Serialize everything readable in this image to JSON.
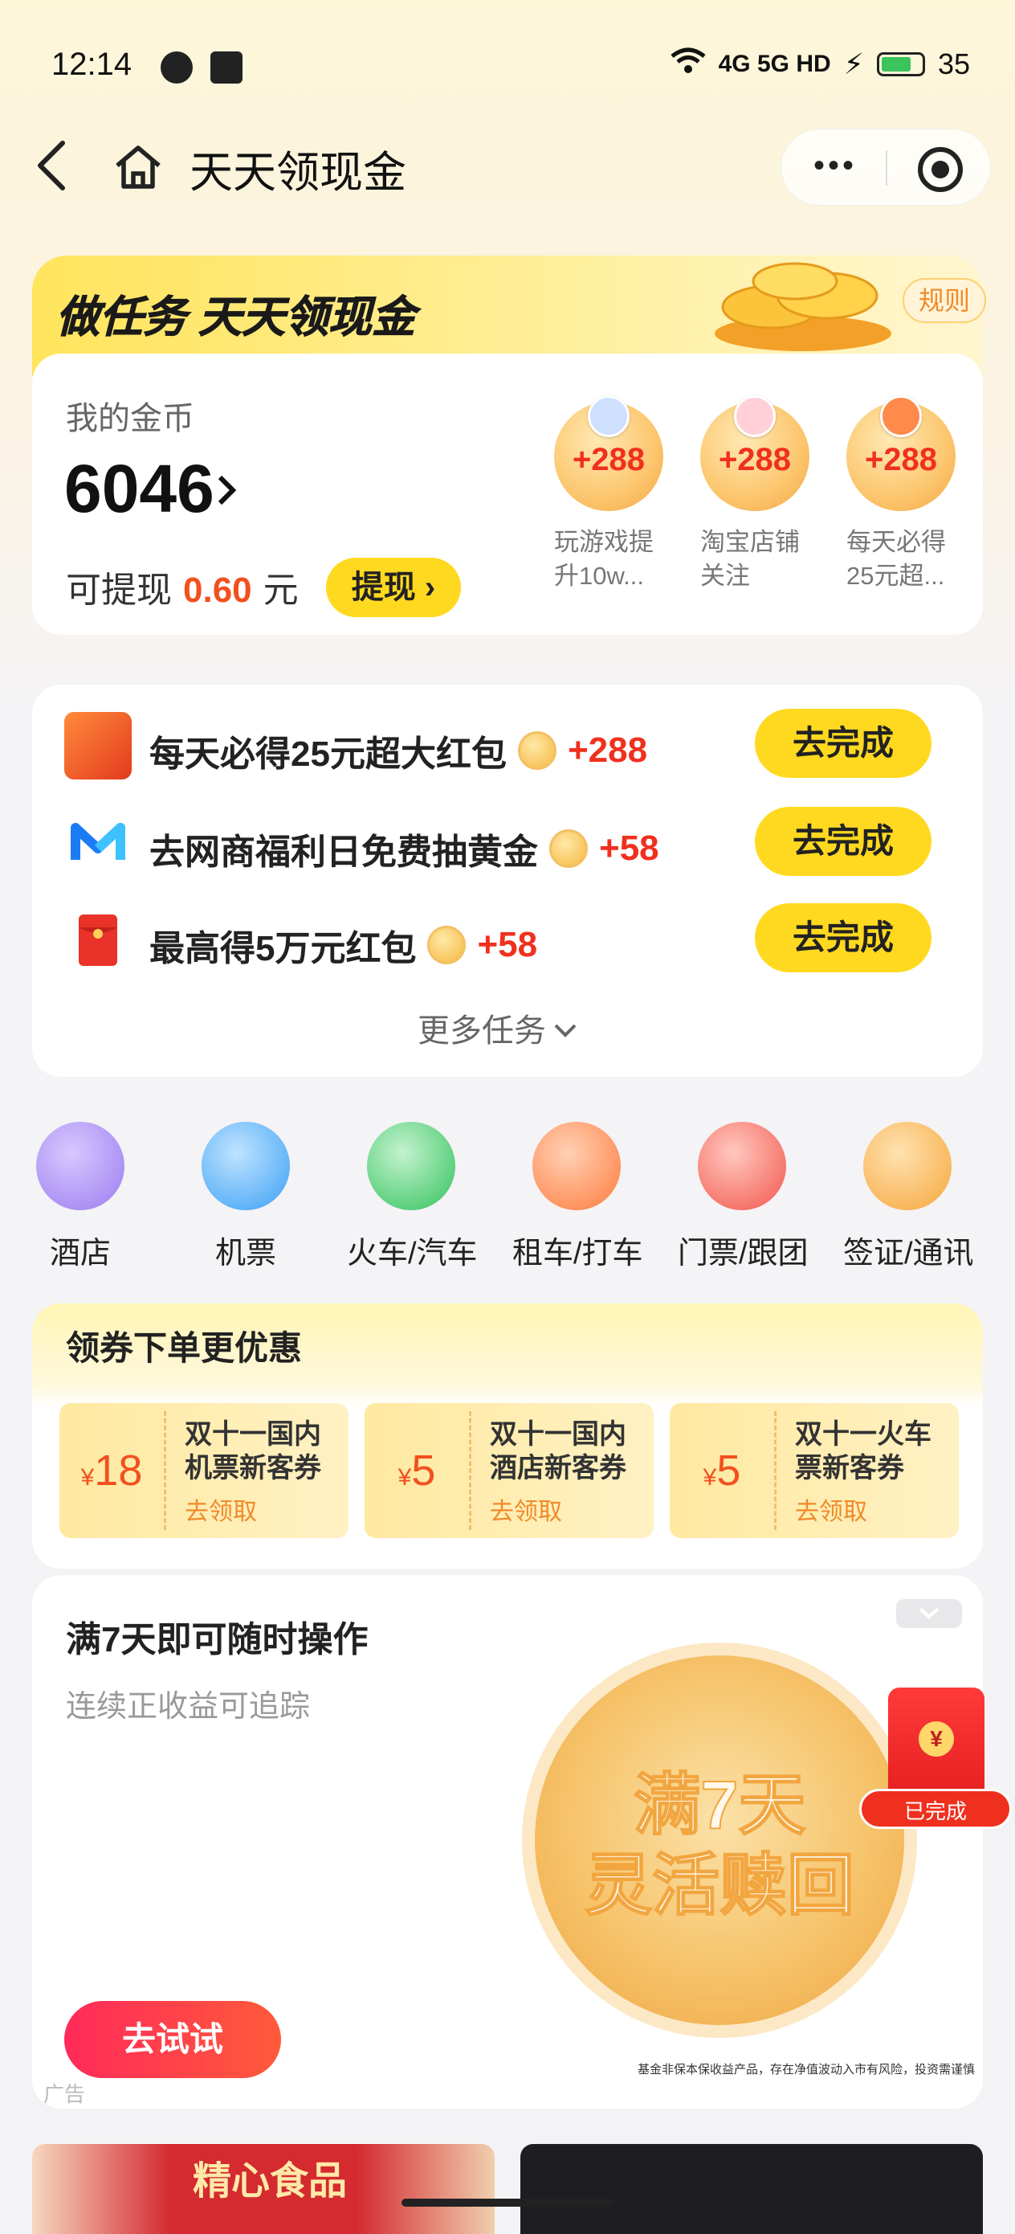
{
  "status_bar": {
    "time": "12:14",
    "network": "4G 5G HD",
    "battery": "35"
  },
  "nav": {
    "title": "天天领现金"
  },
  "banner": {
    "title": "做任务 天天领现金",
    "rule": "规则"
  },
  "coins": {
    "label": "我的金币",
    "value": "6046",
    "withdraw_label": "可提现",
    "withdraw_amount": "0.60",
    "withdraw_unit": "元",
    "withdraw_button": "提现"
  },
  "mini_tasks": [
    {
      "reward": "+288",
      "label_line1": "玩游戏提",
      "label_line2": "升10w..."
    },
    {
      "reward": "+288",
      "label_line1": "淘宝店铺",
      "label_line2": "关注"
    },
    {
      "reward": "+288",
      "label_line1": "每天必得",
      "label_line2": "25元超..."
    }
  ],
  "tasks": [
    {
      "title": "每天必得25元超大红包",
      "reward": "+288",
      "button": "去完成"
    },
    {
      "title": "去网商福利日免费抽黄金",
      "reward": "+58",
      "button": "去完成"
    },
    {
      "title": "最高得5万元红包",
      "reward": "+58",
      "button": "去完成"
    }
  ],
  "more_tasks": "更多任务",
  "categories": [
    {
      "label": "酒店",
      "color": "#9b7cf0"
    },
    {
      "label": "机票",
      "color": "#3aa0f5"
    },
    {
      "label": "火车/汽车",
      "color": "#31c25c"
    },
    {
      "label": "租车/打车",
      "color": "#ff7a3c"
    },
    {
      "label": "门票/跟团",
      "color": "#f2554a"
    },
    {
      "label": "签证/通讯",
      "color": "#f6a63b"
    }
  ],
  "coupons": {
    "title": "领券下单更优惠",
    "items": [
      {
        "symbol": "¥",
        "amount": "18",
        "line1": "双十一国内",
        "line2": "机票新客券",
        "claim": "去领取"
      },
      {
        "symbol": "¥",
        "amount": "5",
        "line1": "双十一国内",
        "line2": "酒店新客券",
        "claim": "去领取"
      },
      {
        "symbol": "¥",
        "amount": "5",
        "line1": "双十一火车",
        "line2": "票新客券",
        "claim": "去领取"
      }
    ]
  },
  "ad": {
    "title": "满7天即可随时操作",
    "subtitle": "连续正收益可追踪",
    "coin_line1": "满7天",
    "coin_line2": "灵活赎回",
    "button": "去试试",
    "tag": "广告",
    "disclaimer": "基金非保本保收益产品，存在净值波动入市有风险，投资需谨慎"
  },
  "float": {
    "done": "已完成",
    "yen": "¥"
  },
  "bottom": {
    "strip1_text": "精心食品"
  }
}
